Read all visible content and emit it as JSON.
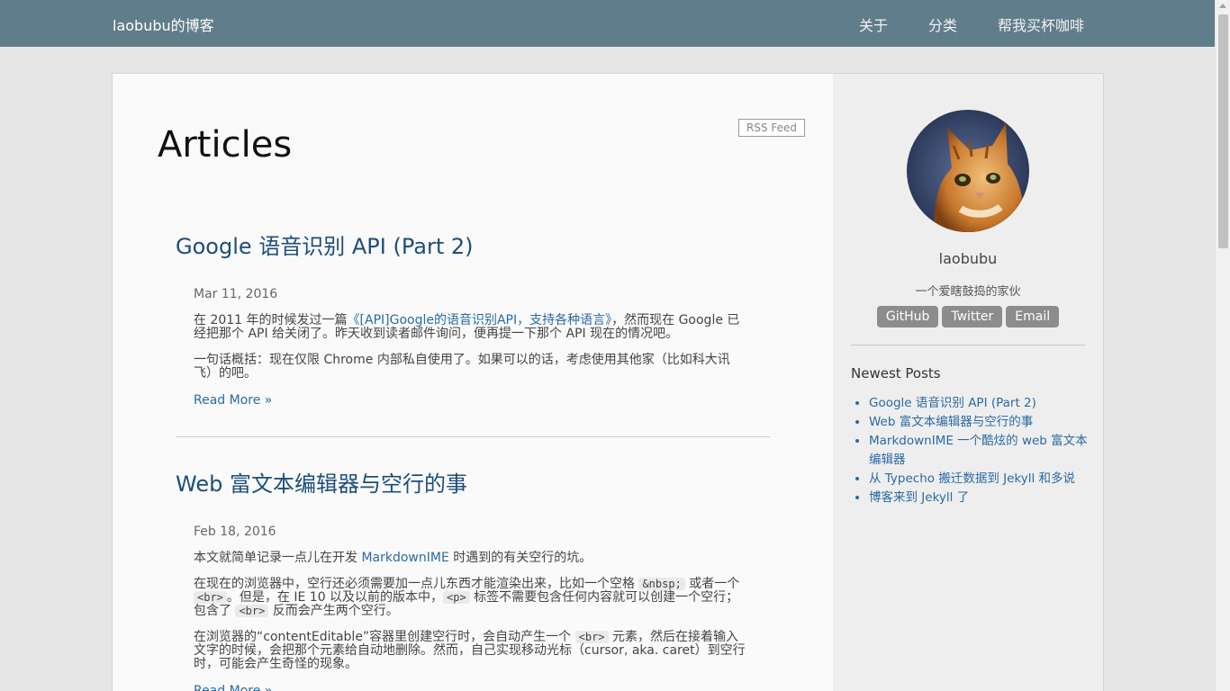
{
  "navbar": {
    "brand": "laobubu的博客",
    "links": [
      "关于",
      "分类",
      "帮我买杯咖啡"
    ]
  },
  "main": {
    "title": "Articles",
    "rss_label": "RSS Feed",
    "posts": [
      {
        "title": "Google 语音识别 API (Part 2)",
        "date": "Mar 11, 2016",
        "p1_before": "在 2011 年的时候发过一篇",
        "p1_link": "《[API]Google的语音识别API，支持各种语言》",
        "p1_after": "，然而现在 Google 已经把那个 API 给关闭了。昨天收到读者邮件询问，便再提一下那个 API 现在的情况吧。",
        "p2": "一句话概括：现在仅限 Chrome 内部私自使用了。如果可以的话，考虑使用其他家（比如科大讯飞）的吧。",
        "read_more": "Read More »"
      },
      {
        "title": "Web 富文本编辑器与空行的事",
        "date": "Feb 18, 2016",
        "p1_before": "本文就简单记录一点儿在开发 ",
        "p1_link": "MarkdownIME",
        "p1_after": " 时遇到的有关空行的坑。",
        "p2_a": "在现在的浏览器中，空行还必须需要加一点儿东西才能渲染出来，比如一个空格 ",
        "code_nbsp": "&nbsp;",
        "p2_b": " 或者一个 ",
        "code_br": "<br>",
        "p2_c": "。但是，在 IE 10 以及以前的版本中，",
        "code_p": "<p>",
        "p2_d": " 标签不需要包含任何内容就可以创建一个空行；包含了 ",
        "p2_e": " 反而会产生两个空行。",
        "p3_a": "在浏览器的“contentEditable”容器里创建空行时，会自动产生一个 ",
        "p3_b": " 元素，然后在接着输入文字的时候，会把那个元素给自动地删除。然而，自己实现移动光标（cursor, aka. caret）到空行时，可能会产生奇怪的现象。",
        "read_more": "Read More »"
      }
    ]
  },
  "aside": {
    "author": "laobubu",
    "tagline": "一个爱瞎鼓捣的家伙",
    "social": [
      "GitHub",
      "Twitter",
      "Email"
    ],
    "newest_title": "Newest Posts",
    "newest": [
      "Google 语音识别 API (Part 2)",
      "Web 富文本编辑器与空行的事",
      "MarkdownIME 一个酷炫的 web 富文本编辑器",
      "从 Typecho 搬迁数据到 Jekyll 和多说",
      "博客来到 Jekyll 了"
    ]
  }
}
